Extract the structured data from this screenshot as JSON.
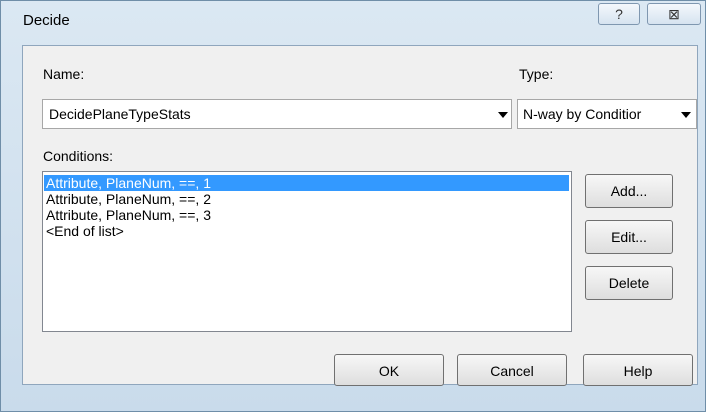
{
  "window": {
    "title": "Decide",
    "help_glyph": "?",
    "close_glyph": "⊠"
  },
  "name": {
    "label": "Name:",
    "value": "DecidePlaneTypeStats"
  },
  "type": {
    "label": "Type:",
    "value": "N-way by Conditior"
  },
  "conditions": {
    "label": "Conditions:",
    "items": [
      {
        "text": "Attribute, PlaneNum, ==, 1",
        "selected": true
      },
      {
        "text": "Attribute, PlaneNum, ==, 2",
        "selected": false
      },
      {
        "text": "Attribute, PlaneNum, ==, 3",
        "selected": false
      },
      {
        "text": "<End of list>",
        "selected": false
      }
    ]
  },
  "buttons": {
    "add": "Add...",
    "edit": "Edit...",
    "delete": "Delete",
    "ok": "OK",
    "cancel": "Cancel",
    "help": "Help"
  },
  "colors": {
    "selection": "#3399ff",
    "frame": "#c9dbeb"
  }
}
